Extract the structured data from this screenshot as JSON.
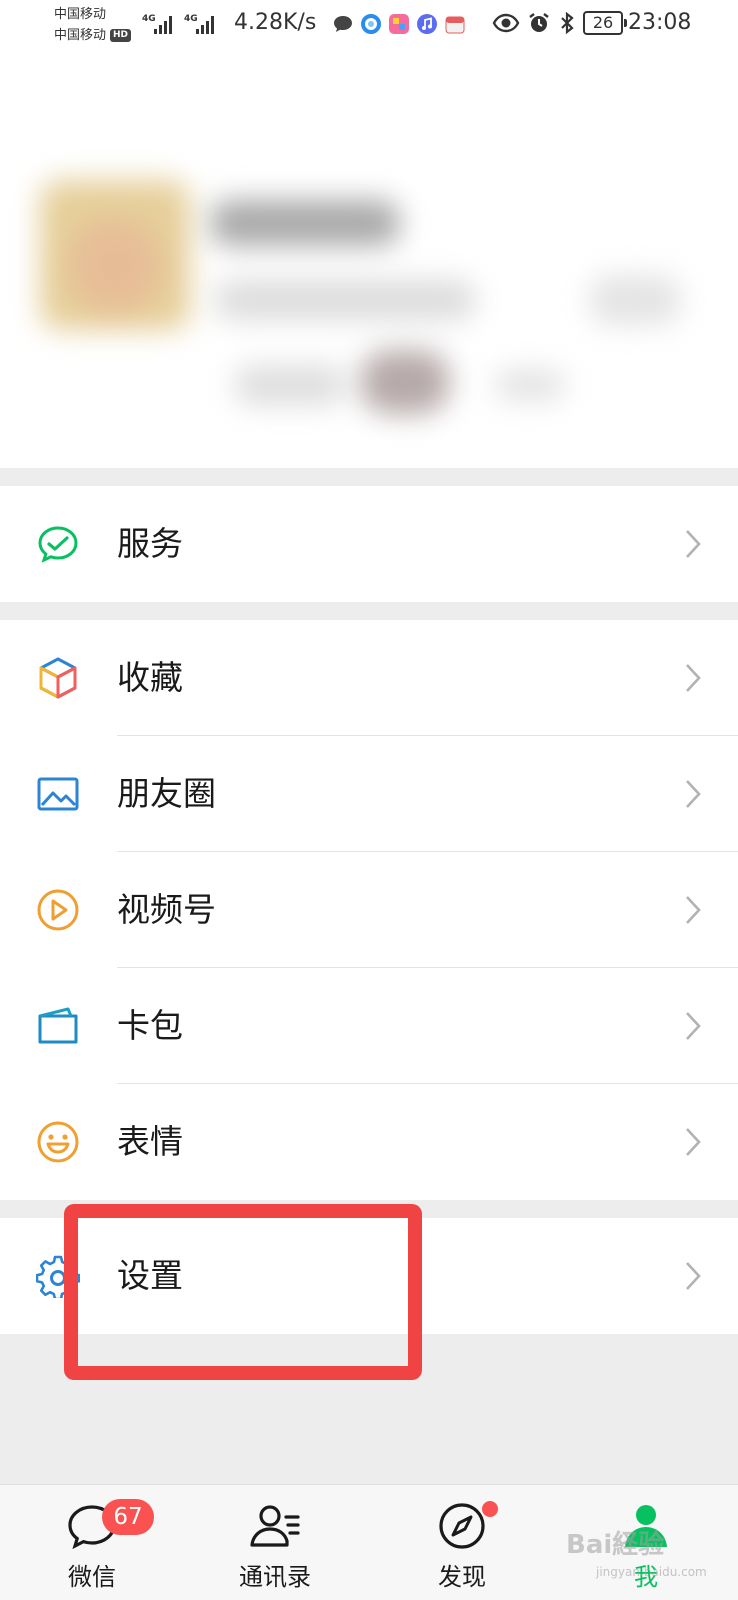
{
  "status_bar": {
    "carrier_1": "中国移动",
    "carrier_2": "中国移动",
    "hd_badge": "HD",
    "network_label_1": "4G",
    "network_label_2": "4G",
    "net_speed": "4.28K/s",
    "battery": "26",
    "time": "23:08"
  },
  "menu": {
    "service": {
      "label": "服务",
      "icon": "service-icon",
      "color": "#07c160"
    },
    "favorites": {
      "label": "收藏",
      "icon": "favorites-cube-icon"
    },
    "moments": {
      "label": "朋友圈",
      "icon": "moments-picture-icon",
      "color": "#2c84d4"
    },
    "channels": {
      "label": "视频号",
      "icon": "channels-play-icon",
      "color": "#ef9f31"
    },
    "cards": {
      "label": "卡包",
      "icon": "card-wallet-icon",
      "color": "#1e8bc3"
    },
    "stickers": {
      "label": "表情",
      "icon": "sticker-smile-icon",
      "color": "#f0a030"
    },
    "settings": {
      "label": "设置",
      "icon": "settings-gear-icon",
      "color": "#2c84d4"
    }
  },
  "tab_bar": {
    "chats": {
      "label": "微信",
      "badge": "67"
    },
    "contacts": {
      "label": "通讯录"
    },
    "discover": {
      "label": "发现"
    },
    "me": {
      "label": "我",
      "active_color": "#07c160"
    }
  },
  "watermark": {
    "main": "Bai経验",
    "sub": "jingyan.baidu.com"
  },
  "colors": {
    "accent": "#07c160",
    "badge": "#fa5151",
    "highlight": "#f04444"
  }
}
